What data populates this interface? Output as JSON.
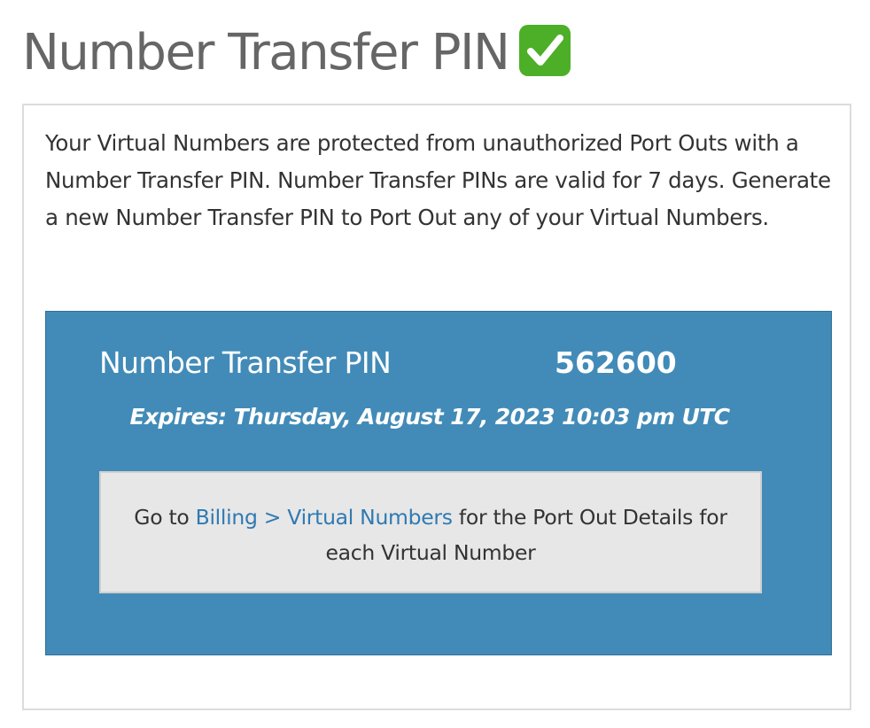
{
  "page": {
    "title": "Number Transfer PIN",
    "title_icon": "check-mark-button-icon",
    "title_icon_color": "#4caf27"
  },
  "card": {
    "intro": "Your Virtual Numbers are protected from unauthorized Port Outs with a Number Transfer PIN. Number Transfer PINs are valid for 7 days. Generate a new Number Transfer PIN to Port Out any of your Virtual Numbers."
  },
  "pin": {
    "label": "Number Transfer PIN",
    "value": "562600",
    "expires": "Expires: Thursday, August 17, 2023 10:03 pm UTC",
    "box_color": "#428bb8"
  },
  "info": {
    "prefix": "Go to ",
    "link_label": "Billing > Virtual Numbers",
    "suffix": " for the Port Out Details for each Virtual Number",
    "link_color": "#2f7ab2"
  }
}
